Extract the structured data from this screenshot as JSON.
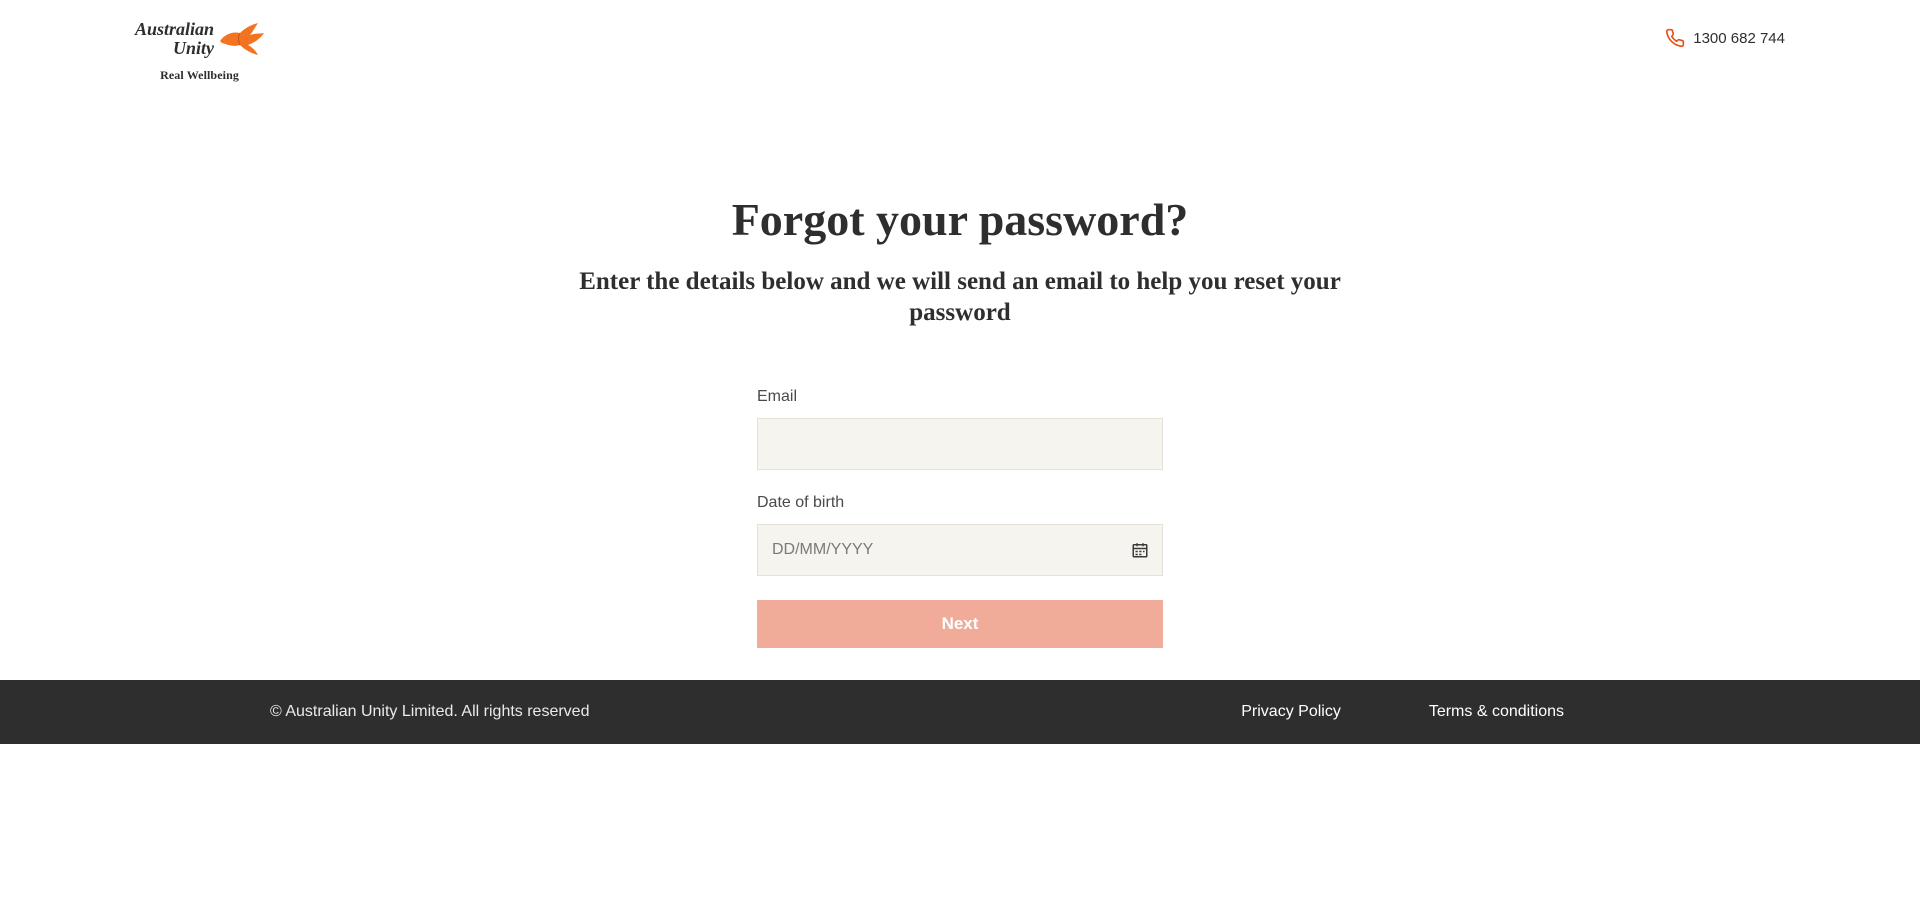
{
  "header": {
    "logo": {
      "line1": "Australian",
      "line2": "Unity",
      "tagline": "Real Wellbeing"
    },
    "phone": {
      "number": "1300 682 744"
    }
  },
  "main": {
    "title": "Forgot your password?",
    "subtitle": "Enter the details below and we will send an email to help you reset your password"
  },
  "form": {
    "email_label": "Email",
    "email_value": "",
    "dob_label": "Date of birth",
    "dob_placeholder": "DD/MM/YYYY",
    "dob_value": "",
    "next_label": "Next"
  },
  "footer": {
    "copyright": "© Australian Unity Limited. All rights reserved",
    "links": {
      "privacy": "Privacy Policy",
      "terms": "Terms & conditions"
    }
  },
  "colors": {
    "accent": "#e5531b",
    "button": "#f0ac99",
    "input_bg": "#f6f4ef",
    "input_border": "#e6e1d8",
    "footer_bg": "#2e2e2e"
  }
}
